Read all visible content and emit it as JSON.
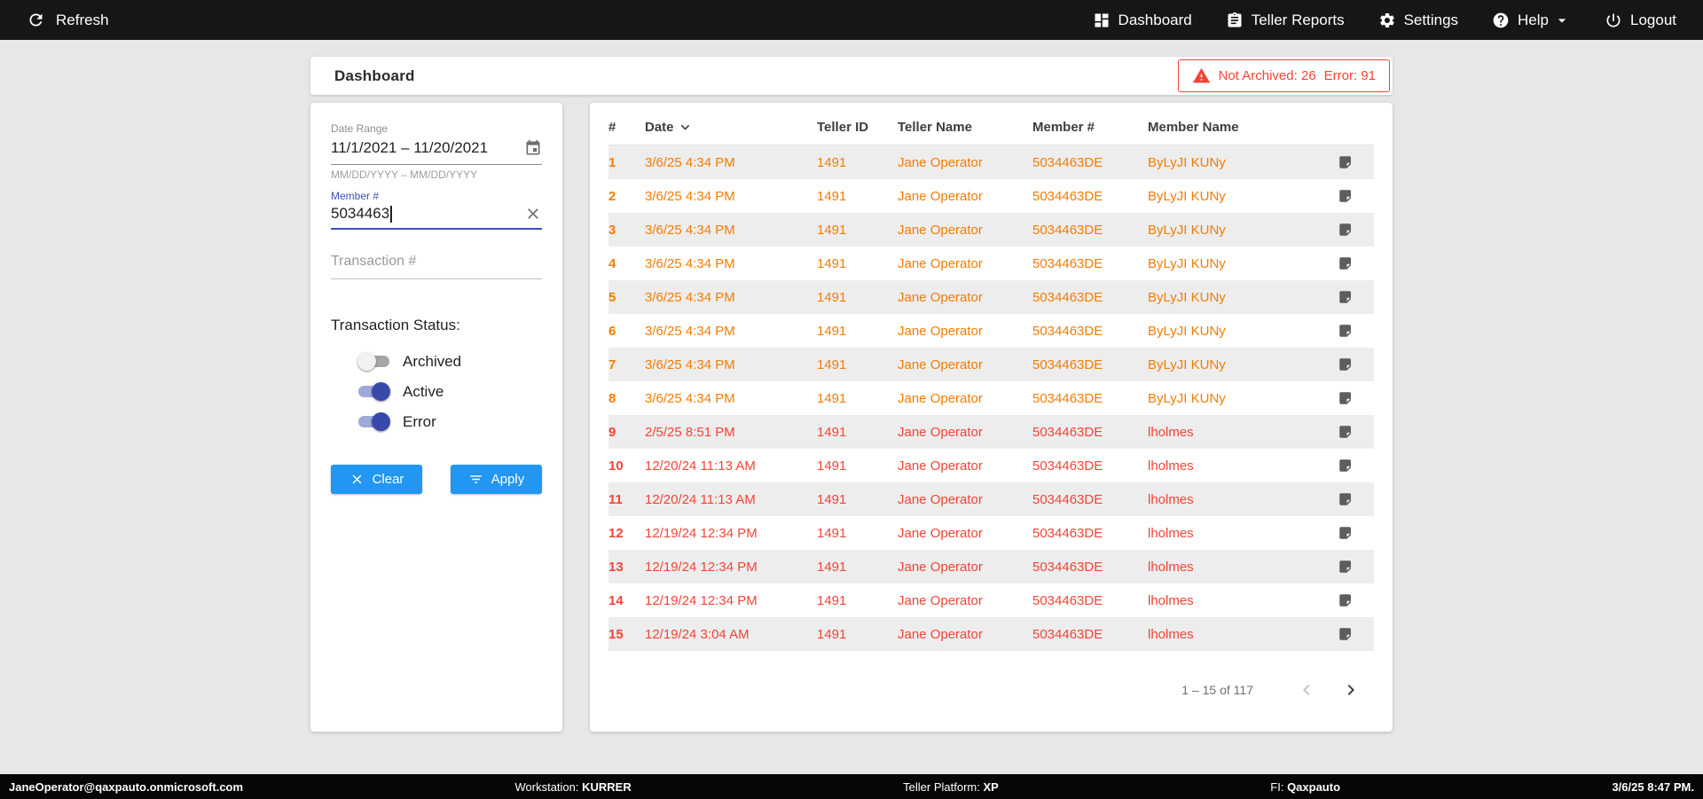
{
  "colors": {
    "accent_blue": "#2196f3",
    "primary_indigo": "#3f51b5",
    "warning_orange": "#f57c00",
    "error_red": "#f44336"
  },
  "topbar": {
    "refresh_label": "Refresh",
    "nav": [
      {
        "id": "dashboard",
        "label": "Dashboard",
        "icon": "dashboard-icon"
      },
      {
        "id": "teller-reports",
        "label": "Teller Reports",
        "icon": "clipboard-icon"
      },
      {
        "id": "settings",
        "label": "Settings",
        "icon": "gear-icon"
      },
      {
        "id": "help",
        "label": "Help",
        "icon": "help-icon",
        "caret": true
      },
      {
        "id": "logout",
        "label": "Logout",
        "icon": "power-icon"
      }
    ]
  },
  "header": {
    "title": "Dashboard",
    "alert": {
      "not_archived": "Not Archived: 26",
      "error": "Error: 91"
    }
  },
  "filters": {
    "date_range_label": "Date Range",
    "date_range_value": "11/1/2021 – 11/20/2021",
    "date_range_hint": "MM/DD/YYYY – MM/DD/YYYY",
    "member_label": "Member #",
    "member_value": "5034463",
    "transaction_placeholder": "Transaction #",
    "status_label": "Transaction Status:",
    "toggles": [
      {
        "label": "Archived",
        "on": false
      },
      {
        "label": "Active",
        "on": true
      },
      {
        "label": "Error",
        "on": true
      }
    ],
    "clear_label": "Clear",
    "apply_label": "Apply"
  },
  "table": {
    "columns": [
      "#",
      "Date",
      "Teller ID",
      "Teller Name",
      "Member #",
      "Member Name"
    ],
    "sort_column": "Date",
    "rows": [
      {
        "num": "1",
        "date": "3/6/25 4:34 PM",
        "teller_id": "1491",
        "teller_name": "Jane Operator",
        "member_num": "5034463DE",
        "member_name": "ByLyJI KUNy",
        "status": "warning"
      },
      {
        "num": "2",
        "date": "3/6/25 4:34 PM",
        "teller_id": "1491",
        "teller_name": "Jane Operator",
        "member_num": "5034463DE",
        "member_name": "ByLyJI KUNy",
        "status": "warning"
      },
      {
        "num": "3",
        "date": "3/6/25 4:34 PM",
        "teller_id": "1491",
        "teller_name": "Jane Operator",
        "member_num": "5034463DE",
        "member_name": "ByLyJI KUNy",
        "status": "warning"
      },
      {
        "num": "4",
        "date": "3/6/25 4:34 PM",
        "teller_id": "1491",
        "teller_name": "Jane Operator",
        "member_num": "5034463DE",
        "member_name": "ByLyJI KUNy",
        "status": "warning"
      },
      {
        "num": "5",
        "date": "3/6/25 4:34 PM",
        "teller_id": "1491",
        "teller_name": "Jane Operator",
        "member_num": "5034463DE",
        "member_name": "ByLyJI KUNy",
        "status": "warning"
      },
      {
        "num": "6",
        "date": "3/6/25 4:34 PM",
        "teller_id": "1491",
        "teller_name": "Jane Operator",
        "member_num": "5034463DE",
        "member_name": "ByLyJI KUNy",
        "status": "warning"
      },
      {
        "num": "7",
        "date": "3/6/25 4:34 PM",
        "teller_id": "1491",
        "teller_name": "Jane Operator",
        "member_num": "5034463DE",
        "member_name": "ByLyJI KUNy",
        "status": "warning"
      },
      {
        "num": "8",
        "date": "3/6/25 4:34 PM",
        "teller_id": "1491",
        "teller_name": "Jane Operator",
        "member_num": "5034463DE",
        "member_name": "ByLyJI KUNy",
        "status": "warning"
      },
      {
        "num": "9",
        "date": "2/5/25 8:51 PM",
        "teller_id": "1491",
        "teller_name": "Jane Operator",
        "member_num": "5034463DE",
        "member_name": "lholmes",
        "status": "error"
      },
      {
        "num": "10",
        "date": "12/20/24 11:13 AM",
        "teller_id": "1491",
        "teller_name": "Jane Operator",
        "member_num": "5034463DE",
        "member_name": "lholmes",
        "status": "error"
      },
      {
        "num": "11",
        "date": "12/20/24 11:13 AM",
        "teller_id": "1491",
        "teller_name": "Jane Operator",
        "member_num": "5034463DE",
        "member_name": "lholmes",
        "status": "error"
      },
      {
        "num": "12",
        "date": "12/19/24 12:34 PM",
        "teller_id": "1491",
        "teller_name": "Jane Operator",
        "member_num": "5034463DE",
        "member_name": "lholmes",
        "status": "error"
      },
      {
        "num": "13",
        "date": "12/19/24 12:34 PM",
        "teller_id": "1491",
        "teller_name": "Jane Operator",
        "member_num": "5034463DE",
        "member_name": "lholmes",
        "status": "error"
      },
      {
        "num": "14",
        "date": "12/19/24 12:34 PM",
        "teller_id": "1491",
        "teller_name": "Jane Operator",
        "member_num": "5034463DE",
        "member_name": "lholmes",
        "status": "error"
      },
      {
        "num": "15",
        "date": "12/19/24 3:04 AM",
        "teller_id": "1491",
        "teller_name": "Jane Operator",
        "member_num": "5034463DE",
        "member_name": "lholmes",
        "status": "error"
      }
    ],
    "pagination": {
      "label": "1 – 15 of 117"
    }
  },
  "footer": {
    "user": "JaneOperator@qaxpauto.onmicrosoft.com",
    "workstation_label": "Workstation:",
    "workstation_value": "KURRER",
    "platform_label": "Teller Platform:",
    "platform_value": "XP",
    "fi_label": "FI:",
    "fi_value": "Qaxpauto",
    "datetime": "3/6/25 8:47 PM."
  }
}
